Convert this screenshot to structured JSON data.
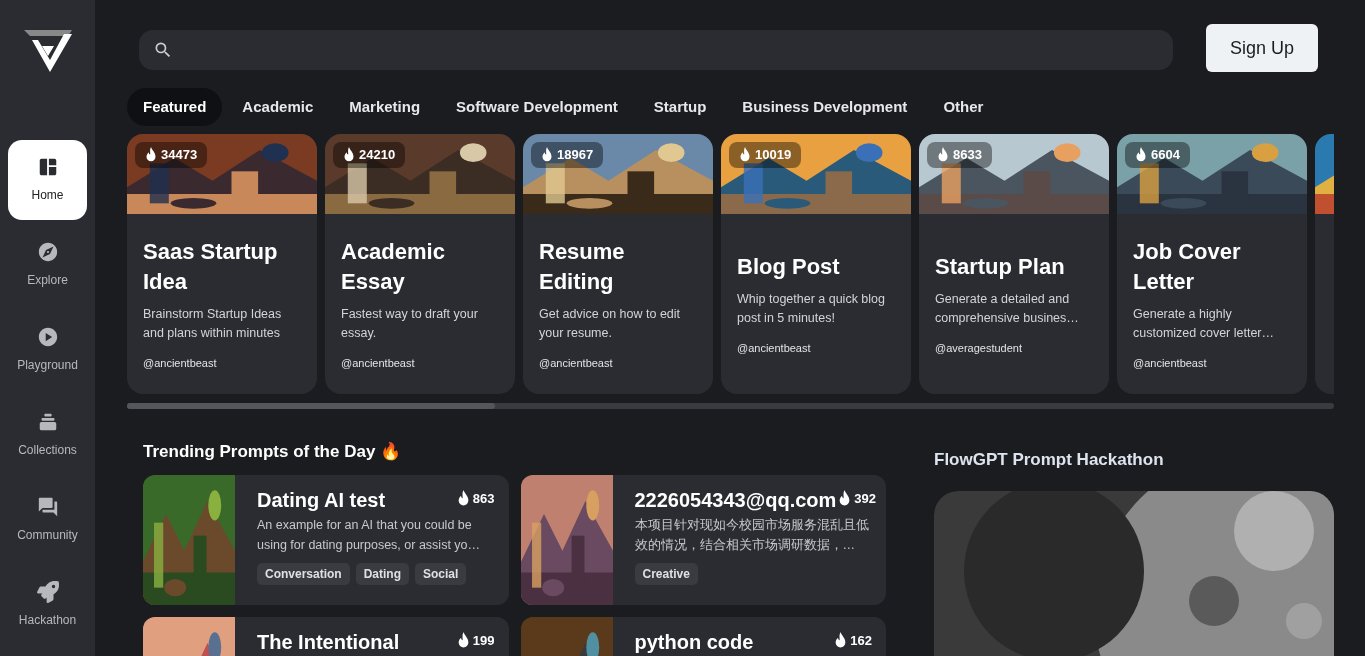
{
  "sidebar": {
    "items": [
      {
        "label": "Home",
        "selected": true
      },
      {
        "label": "Explore",
        "selected": false
      },
      {
        "label": "Playground",
        "selected": false
      },
      {
        "label": "Collections",
        "selected": false
      },
      {
        "label": "Community",
        "selected": false
      },
      {
        "label": "Hackathon",
        "selected": false
      }
    ]
  },
  "header": {
    "sign_up": "Sign Up"
  },
  "tabs": [
    {
      "label": "Featured",
      "selected": true
    },
    {
      "label": "Academic",
      "selected": false
    },
    {
      "label": "Marketing",
      "selected": false
    },
    {
      "label": "Software Development",
      "selected": false
    },
    {
      "label": "Startup",
      "selected": false
    },
    {
      "label": "Business Development",
      "selected": false
    },
    {
      "label": "Other",
      "selected": false
    }
  ],
  "featured": [
    {
      "count": "34473",
      "title": "Saas Startup Idea",
      "description": "Brainstorm Startup Ideas and plans within minutes",
      "author": "@ancientbeast"
    },
    {
      "count": "24210",
      "title": "Academic Essay",
      "description": "Fastest way to draft your essay.",
      "author": "@ancientbeast"
    },
    {
      "count": "18967",
      "title": "Resume Editing",
      "description": "Get advice on how to edit your resume.",
      "author": "@ancientbeast"
    },
    {
      "count": "10019",
      "title": "Blog Post",
      "description": "Whip together a quick blog post in 5 minutes!",
      "author": "@ancientbeast"
    },
    {
      "count": "8633",
      "title": "Startup Plan",
      "description": "Generate a detailed and comprehensive busines…",
      "author": "@averagestudent"
    },
    {
      "count": "6604",
      "title": "Job Cover Letter",
      "description": "Generate a highly customized cover letter…",
      "author": "@ancientbeast"
    }
  ],
  "trending": {
    "title": "Trending Prompts of the Day 🔥",
    "items": [
      {
        "title": "Dating AI test",
        "count": "863",
        "description": "An example for an AI that you could be using for dating purposes, or assist yo…",
        "tags": [
          "Conversation",
          "Dating",
          "Social"
        ]
      },
      {
        "title": "2226054343@qq.com",
        "count": "392",
        "description": "本项目针对现如今校园市场服务混乱且低效的情况，结合相关市场调研数据，…",
        "tags": [
          "Creative"
        ]
      },
      {
        "title": "The Intentional",
        "count": "199"
      },
      {
        "title": "python code",
        "count": "162"
      }
    ]
  },
  "hackathon": {
    "title": "FlowGPT Prompt Hackathon"
  }
}
